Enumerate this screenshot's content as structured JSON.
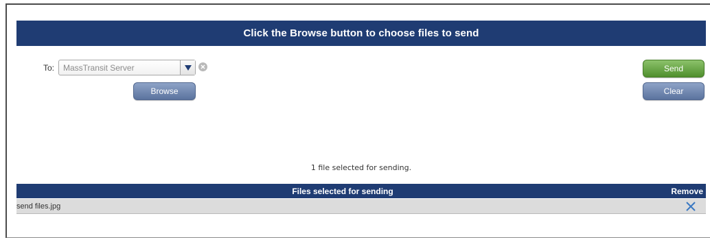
{
  "header": {
    "banner_text": "Click the Browse button to choose files to send"
  },
  "recipient": {
    "label": "To:",
    "selected_value": "MassTransit Server"
  },
  "buttons": {
    "browse": "Browse",
    "send": "Send",
    "clear": "Clear"
  },
  "status": {
    "text": "1 file selected for sending."
  },
  "files_table": {
    "columns": {
      "files": "Files selected for sending",
      "remove": "Remove"
    },
    "rows": [
      {
        "name": "send files.jpg",
        "remove_icon": "close-icon"
      }
    ]
  },
  "colors": {
    "banner": "#1f3c73",
    "send_button": "#4f8f2d",
    "secondary_button": "#5b739e",
    "remove_icon": "#3a78c2",
    "row_background": "#dcdcdc"
  }
}
